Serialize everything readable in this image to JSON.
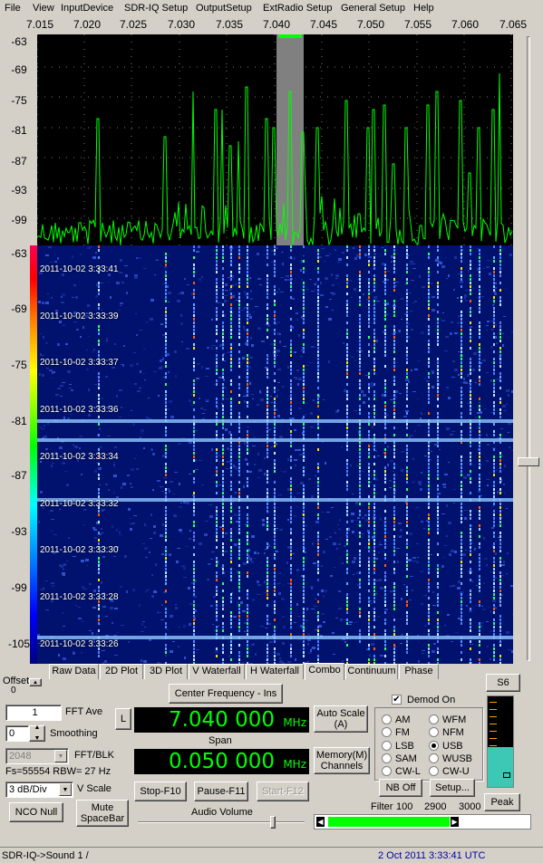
{
  "menu": [
    "File",
    "View",
    "InputDevice",
    "SDR-IQ Setup",
    "OutputSetup",
    "ExtRadio Setup",
    "General Setup",
    "Help"
  ],
  "freq_axis": [
    "7.015",
    "7.020",
    "7.025",
    "7.030",
    "7.035",
    "7.040",
    "7.045",
    "7.050",
    "7.055",
    "7.060",
    "7.065"
  ],
  "spectrum_db_axis": [
    "-63",
    "-69",
    "-75",
    "-81",
    "-87",
    "-93",
    "-99"
  ],
  "waterfall_db_axis": [
    "-63",
    "-69",
    "-75",
    "-81",
    "-87",
    "-93",
    "-99",
    "-105"
  ],
  "timestamps": [
    "2011-10-02 3:33:41",
    "2011-10-02 3:33:39",
    "2011-10-02 3:33:37",
    "2011-10-02 3:33:36",
    "2011-10-02 3:33:34",
    "2011-10-02 3:33:32",
    "2011-10-02 3:33:30",
    "2011-10-02 3:33:28",
    "2011-10-02 3:33:26"
  ],
  "tabs": [
    "Raw Data",
    "2D Plot",
    "3D Plot",
    "V Waterfall",
    "H Waterfall",
    "Combo",
    "Continuum",
    "Phase"
  ],
  "active_tab": "Combo",
  "offset": {
    "label": "Offset",
    "value": "0"
  },
  "fft_ave": {
    "value": "1",
    "label": "FFT Ave"
  },
  "smoothing": {
    "value": "0",
    "label": "Smoothing"
  },
  "fft_blk": {
    "value": "2048",
    "label": "FFT/BLK"
  },
  "fs_text": "Fs=55554 RBW= 27 Hz",
  "vscale": {
    "value": "3 dB/Div",
    "label": "V Scale"
  },
  "buttons": {
    "center_freq": "Center Frequency - Ins",
    "l": "L",
    "auto_scale": "Auto Scale (A)",
    "memory": "Memory(M) Channels",
    "stop": "Stop-F10",
    "pause": "Pause-F11",
    "start": "Start-F12",
    "nco_null": "NCO Null",
    "mute": "Mute SpaceBar",
    "nb_off": "NB Off",
    "setup": "Setup...",
    "s6": "S6",
    "peak": "Peak"
  },
  "frequency": {
    "value": "7.040 000",
    "unit": "MHz"
  },
  "span": {
    "label": "Span",
    "value": "0.050 000",
    "unit": "MHz"
  },
  "audio_volume_label": "Audio Volume",
  "demod": {
    "label": "Demod On",
    "checked": true
  },
  "modes": [
    {
      "label": "AM",
      "selected": false
    },
    {
      "label": "WFM",
      "selected": false
    },
    {
      "label": "FM",
      "selected": false
    },
    {
      "label": "NFM",
      "selected": false
    },
    {
      "label": "LSB",
      "selected": false
    },
    {
      "label": "USB",
      "selected": true
    },
    {
      "label": "SAM",
      "selected": false
    },
    {
      "label": "WUSB",
      "selected": false
    },
    {
      "label": "CW-L",
      "selected": false
    },
    {
      "label": "CW-U",
      "selected": false
    }
  ],
  "filter": {
    "label": "Filter",
    "low": "100",
    "mid": "2900",
    "high": "3000"
  },
  "status": {
    "left": "SDR-IQ->Sound 1  /",
    "right": "2 Oct 2011  3:33:41 UTC"
  },
  "colors": {
    "trace": "#00ff00",
    "waterfall_bg": "#00126e",
    "status_text": "#0000a0"
  }
}
